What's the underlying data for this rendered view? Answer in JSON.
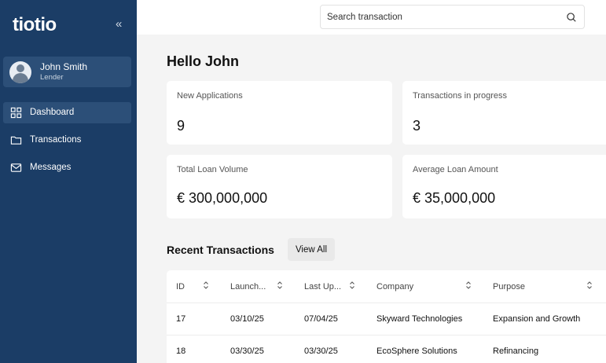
{
  "app": {
    "logo": "tiotio"
  },
  "sidebar": {
    "collapse_glyph": "«",
    "user": {
      "name": "John Smith",
      "role": "Lender"
    },
    "items": [
      {
        "label": "Dashboard",
        "icon": "grid-icon",
        "active": true
      },
      {
        "label": "Transactions",
        "icon": "folder-icon",
        "active": false
      },
      {
        "label": "Messages",
        "icon": "mail-icon",
        "active": false
      }
    ]
  },
  "header": {
    "search_placeholder": "Search transaction"
  },
  "main": {
    "greeting": "Hello John",
    "stats": [
      {
        "label": "New Applications",
        "value": "9"
      },
      {
        "label": "Transactions in progress",
        "value": "3"
      },
      {
        "label": "Total Loan Volume",
        "value": "€ 300,000,000"
      },
      {
        "label": "Average Loan Amount",
        "value": "€ 35,000,000"
      }
    ],
    "recent": {
      "title": "Recent Transactions",
      "view_all": "View All",
      "columns": [
        "ID",
        "Launch...",
        "Last Up...",
        "Company",
        "Purpose"
      ],
      "rows": [
        [
          "17",
          "03/10/25",
          "07/04/25",
          "Skyward Technologies",
          "Expansion and Growth"
        ],
        [
          "18",
          "03/30/25",
          "03/30/25",
          "EcoSphere Solutions",
          "Refinancing"
        ]
      ]
    }
  },
  "colors": {
    "sidebar": "#1b3d66",
    "sidebar_active": "#2c4f78",
    "background": "#f4f4f4"
  }
}
